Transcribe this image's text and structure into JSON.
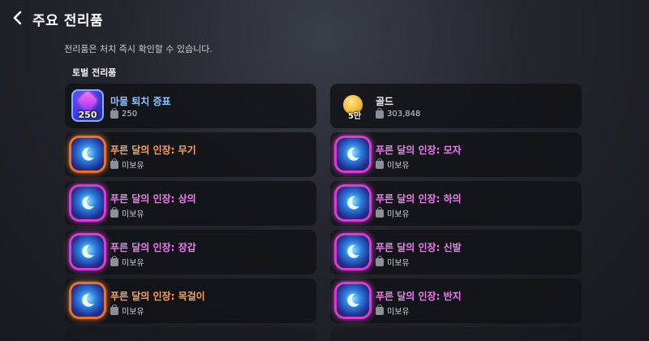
{
  "header": {
    "title": "주요 전리품"
  },
  "subtitle": "전리품은 처치 즉시 확인할 수 있습니다.",
  "section_title": "토벌 전리품",
  "colors": {
    "blue_name": "#8ec5ff",
    "orange_name": "#ffa25a",
    "pink_name": "#f07cf0"
  },
  "items": [
    {
      "name": "마물 퇴치 증표",
      "status": "250",
      "icon": "purple-badge-icon",
      "icon_count": "250",
      "name_color": "#8ec5ff"
    },
    {
      "name": "골드",
      "status": "303,848",
      "icon": "gold-coin-icon",
      "icon_count": "5만",
      "name_color": "#f2f3f6"
    },
    {
      "name": "푸른 달의 인장: 무기",
      "status": "미보유",
      "icon": "blue-moon-seal-icon",
      "frame": "orange",
      "name_color": "#ffa25a"
    },
    {
      "name": "푸른 달의 인장: 모자",
      "status": "미보유",
      "icon": "blue-moon-seal-icon",
      "frame": "pink",
      "name_color": "#f07cf0"
    },
    {
      "name": "푸른 달의 인장: 상의",
      "status": "미보유",
      "icon": "blue-moon-seal-icon",
      "frame": "pink",
      "name_color": "#f07cf0"
    },
    {
      "name": "푸른 달의 인장: 하의",
      "status": "미보유",
      "icon": "blue-moon-seal-icon",
      "frame": "pink",
      "name_color": "#f07cf0"
    },
    {
      "name": "푸른 달의 인장: 장갑",
      "status": "미보유",
      "icon": "blue-moon-seal-icon",
      "frame": "pink",
      "name_color": "#f07cf0"
    },
    {
      "name": "푸른 달의 인장: 신발",
      "status": "미보유",
      "icon": "blue-moon-seal-icon",
      "frame": "pink",
      "name_color": "#f07cf0"
    },
    {
      "name": "푸른 달의 인장: 목걸이",
      "status": "미보유",
      "icon": "blue-moon-seal-icon",
      "frame": "orange",
      "name_color": "#ffa25a"
    },
    {
      "name": "푸른 달의 인장: 반지",
      "status": "미보유",
      "icon": "blue-moon-seal-icon",
      "frame": "pink",
      "name_color": "#f07cf0"
    }
  ]
}
